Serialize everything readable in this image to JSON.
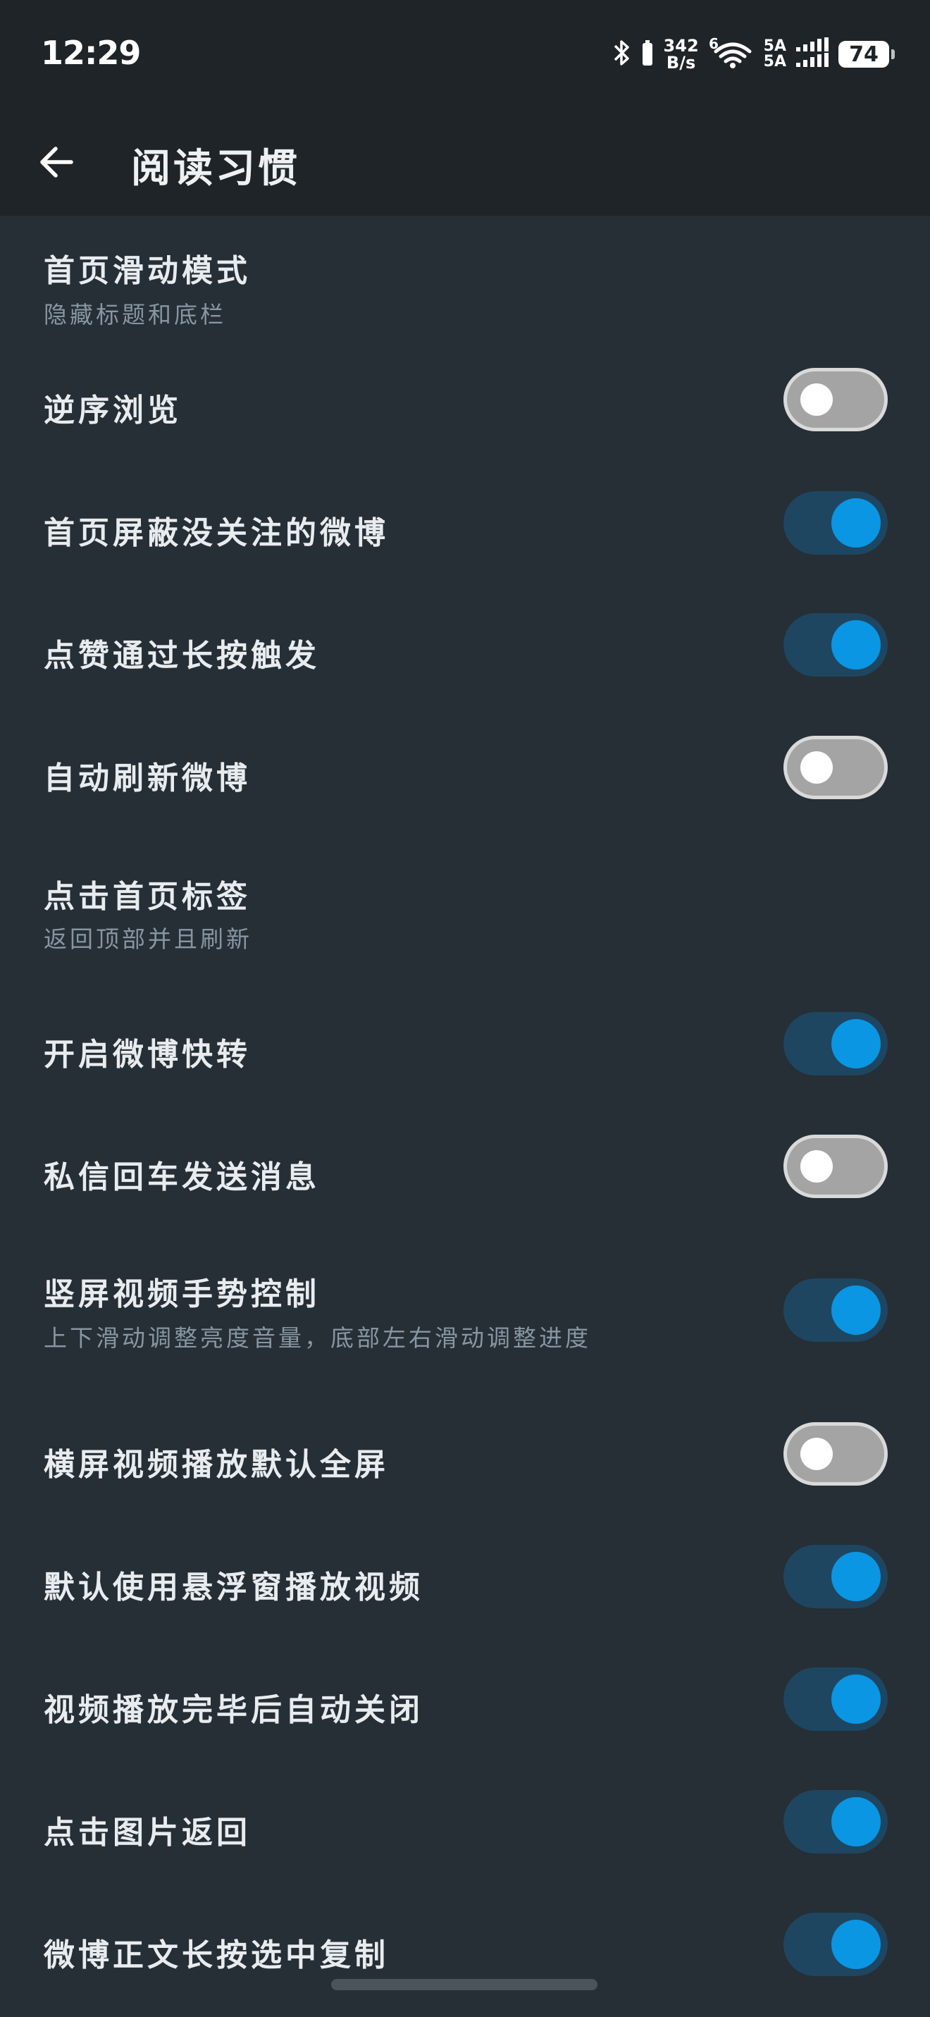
{
  "status_bar": {
    "time": "12:29",
    "net_speed_value": "342",
    "net_speed_unit": "B/s",
    "sim1": "5A",
    "sim2": "5A",
    "battery": "74"
  },
  "header": {
    "title": "阅读习惯"
  },
  "settings": [
    {
      "label": "首页滑动模式",
      "sublabel": "隐藏标题和底栏",
      "toggle": null
    },
    {
      "label": "逆序浏览",
      "sublabel": null,
      "toggle": false
    },
    {
      "label": "首页屏蔽没关注的微博",
      "sublabel": null,
      "toggle": true
    },
    {
      "label": "点赞通过长按触发",
      "sublabel": null,
      "toggle": true
    },
    {
      "label": "自动刷新微博",
      "sublabel": null,
      "toggle": false
    },
    {
      "label": "点击首页标签",
      "sublabel": "返回顶部并且刷新",
      "toggle": null
    },
    {
      "label": "开启微博快转",
      "sublabel": null,
      "toggle": true
    },
    {
      "label": "私信回车发送消息",
      "sublabel": null,
      "toggle": false
    },
    {
      "label": "竖屏视频手势控制",
      "sublabel": "上下滑动调整亮度音量，底部左右滑动调整进度",
      "toggle": true
    },
    {
      "label": "横屏视频播放默认全屏",
      "sublabel": null,
      "toggle": false
    },
    {
      "label": "默认使用悬浮窗播放视频",
      "sublabel": null,
      "toggle": true
    },
    {
      "label": "视频播放完毕后自动关闭",
      "sublabel": null,
      "toggle": true
    },
    {
      "label": "点击图片返回",
      "sublabel": null,
      "toggle": true
    },
    {
      "label": "微博正文长按选中复制",
      "sublabel": null,
      "toggle": true
    }
  ],
  "colors": {
    "background": "#262e36",
    "header_background": "#1e2428",
    "toggle_on": "#0a96e3",
    "toggle_off": "#a4a4a4"
  }
}
